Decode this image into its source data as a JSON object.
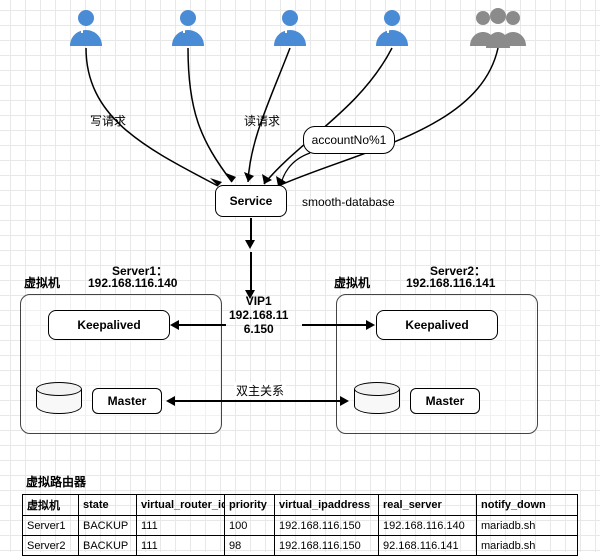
{
  "labels": {
    "write_req": "写请求",
    "read_req": "读请求",
    "account_mod": "accountNo%1",
    "service": "Service",
    "smooth_db": "smooth-database",
    "vm": "虚拟机",
    "server1_title": "Server1：",
    "server1_ip": "192.168.116.140",
    "server2_title": "Server2：",
    "server2_ip": "192.168.116.141",
    "vip_title": "VIP1",
    "vip_line2": "192.168.11",
    "vip_line3": "6.150",
    "keepalived": "Keepalived",
    "master": "Master",
    "dual_master": "双主关系",
    "table_title": "虚拟路由器"
  },
  "table": {
    "headers": [
      "虚拟机",
      "state",
      "virtual_router_id",
      "priority",
      "virtual_ipaddress",
      "real_server",
      "notify_down"
    ],
    "rows": [
      [
        "Server1",
        "BACKUP",
        "111",
        "100",
        "192.168.116.150",
        "192.168.116.140",
        "mariadb.sh"
      ],
      [
        "Server2",
        "BACKUP",
        "111",
        "98",
        "192.168.116.150",
        "92.168.116.141",
        "mariadb.sh"
      ]
    ]
  }
}
